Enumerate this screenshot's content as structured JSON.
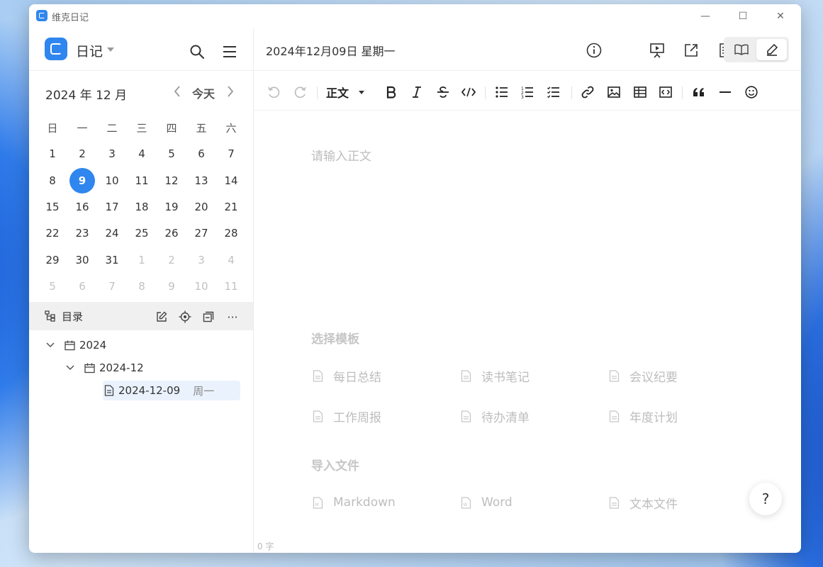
{
  "window": {
    "title": "维克日记",
    "minimize": "—",
    "maximize": "☐",
    "close": "✕"
  },
  "sidebar": {
    "book_name": "日记",
    "month_label": "2024 年 12 月",
    "today": "今天",
    "weekdays": [
      "日",
      "一",
      "二",
      "三",
      "四",
      "五",
      "六"
    ],
    "weeks": [
      [
        "1",
        "2",
        "3",
        "4",
        "5",
        "6",
        "7"
      ],
      [
        "8",
        "9",
        "10",
        "11",
        "12",
        "13",
        "14"
      ],
      [
        "15",
        "16",
        "17",
        "18",
        "19",
        "20",
        "21"
      ],
      [
        "22",
        "23",
        "24",
        "25",
        "26",
        "27",
        "28"
      ],
      [
        "29",
        "30",
        "31",
        "1",
        "2",
        "3",
        "4"
      ],
      [
        "5",
        "6",
        "7",
        "8",
        "9",
        "10",
        "11"
      ]
    ],
    "selected_day": "9",
    "directory_label": "目录",
    "tree": {
      "year": "2024",
      "month": "2024-12",
      "entry_date": "2024-12-09",
      "entry_weekday": "周一"
    }
  },
  "main": {
    "doc_date": "2024年12月09日 星期一",
    "toolbar": {
      "style": "正文"
    },
    "placeholder": "请输入正文",
    "templates_heading": "选择模板",
    "templates": [
      "每日总结",
      "读书笔记",
      "会议纪要",
      "工作周报",
      "待办清单",
      "年度计划"
    ],
    "import_heading": "导入文件",
    "imports": [
      "Markdown",
      "Word",
      "文本文件"
    ],
    "word_count": "0 字",
    "help": "?"
  },
  "colors": {
    "accent": "#2f86ee",
    "muted_text": "#bdbdbd"
  }
}
